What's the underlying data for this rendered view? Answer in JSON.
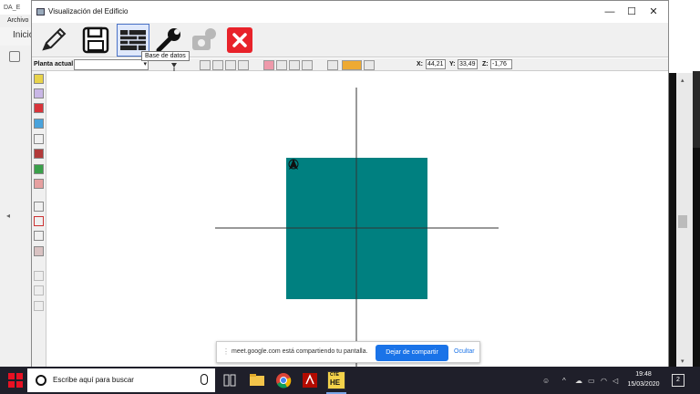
{
  "background_app": {
    "title": "DA_E",
    "menu": "Archivo",
    "tab": "Inicio"
  },
  "window": {
    "title": "Visualización del Edificio",
    "controls": [
      "minimize",
      "maximize",
      "close"
    ]
  },
  "toolbar": {
    "buttons": [
      {
        "name": "pencil-icon",
        "active": false
      },
      {
        "name": "save-icon",
        "active": false
      },
      {
        "name": "database-icon",
        "active": true
      },
      {
        "name": "wrench-icon",
        "active": false
      },
      {
        "name": "tools-disabled-icon",
        "active": false
      },
      {
        "name": "close-red-icon",
        "active": false
      }
    ],
    "tooltip": "Base de datos"
  },
  "secondbar": {
    "planta_label": "Planta actual",
    "planta_value": "",
    "x_label": "X:",
    "x_value": "44,21",
    "y_label": "Y:",
    "y_value": "33,49",
    "z_label": "Z:",
    "z_value": "-1,76"
  },
  "canvas": {
    "shape_color": "#008080",
    "axis_color": "#333333"
  },
  "share_banner": {
    "text": "meet.google.com está compartiendo tu pantalla.",
    "stop_label": "Dejar de compartir",
    "hide_label": "Ocultar"
  },
  "taskbar": {
    "search_placeholder": "Escribe aquí para buscar",
    "time": "19:48",
    "date": "15/03/2020",
    "notification_count": "2",
    "cte_label": "CTE",
    "he_label": "HE"
  }
}
